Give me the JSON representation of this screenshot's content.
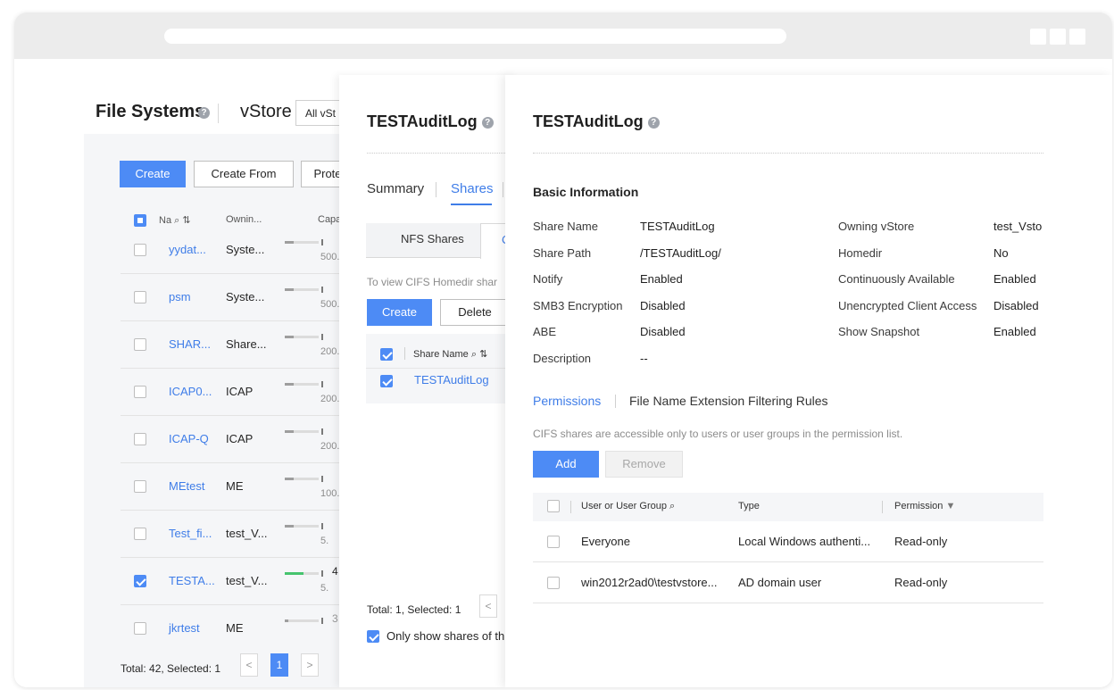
{
  "file_systems": {
    "title": "File Systems",
    "vstore_label": "vStore",
    "vstore_select": "All vSt",
    "buttons": {
      "create": "Create",
      "create_from": "Create From",
      "protect": "Prote"
    },
    "columns": {
      "name": "Na",
      "owning": "Ownin...",
      "capacity": "Capa"
    },
    "rows": [
      {
        "name": "yydat...",
        "owning": "Syste...",
        "cap": "500.",
        "usage": 0.25,
        "checked": false
      },
      {
        "name": "psm",
        "owning": "Syste...",
        "cap": "500.",
        "usage": 0.25,
        "checked": false
      },
      {
        "name": "SHAR...",
        "owning": "Share...",
        "cap": "200.",
        "usage": 0.25,
        "checked": false
      },
      {
        "name": "ICAP0...",
        "owning": "ICAP",
        "cap": "200.",
        "usage": 0.25,
        "checked": false
      },
      {
        "name": "ICAP-Q",
        "owning": "ICAP",
        "cap": "200.",
        "usage": 0.25,
        "checked": false
      },
      {
        "name": "MEtest",
        "owning": "ME",
        "cap": "100.",
        "usage": 0.25,
        "checked": false
      },
      {
        "name": "Test_fi...",
        "owning": "test_V...",
        "cap": "5.",
        "usage": 0.25,
        "checked": false
      },
      {
        "name": "TESTA...",
        "owning": "test_V...",
        "cap": "5.",
        "usage": 0.55,
        "checked": true
      },
      {
        "name": "jkrtest",
        "owning": "ME",
        "cap": "",
        "usage": 0.1,
        "checked": false
      }
    ],
    "cap_big": {
      "r7": "4",
      "r8": "3"
    },
    "footer": "Total: 42, Selected: 1",
    "pager": {
      "prev": "<",
      "page": "1",
      "next": ">"
    }
  },
  "shares_panel": {
    "title": "TESTAuditLog",
    "tabs": {
      "summary": "Summary",
      "shares": "Shares"
    },
    "subtabs": {
      "nfs": "NFS Shares",
      "cifs": "C"
    },
    "hint": "To view CIFS Homedir shar",
    "buttons": {
      "create": "Create",
      "delete": "Delete"
    },
    "column": "Share Name",
    "row": "TESTAuditLog",
    "footer": "Total: 1, Selected: 1",
    "pager_prev": "<",
    "only_show": "Only show shares of th"
  },
  "detail_panel": {
    "title": "TESTAuditLog",
    "section": "Basic Information",
    "left": [
      {
        "label": "Share Name",
        "value": "TESTAuditLog"
      },
      {
        "label": "Share Path",
        "value": "/TESTAuditLog/"
      },
      {
        "label": "Notify",
        "value": "Enabled"
      },
      {
        "label": "SMB3 Encryption",
        "value": "Disabled"
      },
      {
        "label": "ABE",
        "value": "Disabled"
      },
      {
        "label": "Description",
        "value": "--"
      }
    ],
    "right": [
      {
        "label": "Owning vStore",
        "value": "test_Vsto"
      },
      {
        "label": "Homedir",
        "value": "No"
      },
      {
        "label": "Continuously Available",
        "value": "Enabled"
      },
      {
        "label": "Unencrypted Client Access",
        "value": "Disabled"
      },
      {
        "label": "Show Snapshot",
        "value": "Enabled"
      }
    ],
    "tabs": {
      "permissions": "Permissions",
      "filtering": "File Name Extension Filtering Rules"
    },
    "hint": "CIFS shares are accessible only to users or user groups in the permission list.",
    "buttons": {
      "add": "Add",
      "remove": "Remove"
    },
    "columns": {
      "user": "User or User Group",
      "type": "Type",
      "permission": "Permission"
    },
    "rows": [
      {
        "user": "Everyone",
        "type": "Local Windows authenti...",
        "permission": "Read-only"
      },
      {
        "user": "win2012r2ad0\\testvstore...",
        "type": "AD domain user",
        "permission": "Read-only"
      }
    ]
  },
  "colors": {
    "accent": "#4d8bf5",
    "link": "#3f7de8",
    "green": "#46c46e"
  }
}
